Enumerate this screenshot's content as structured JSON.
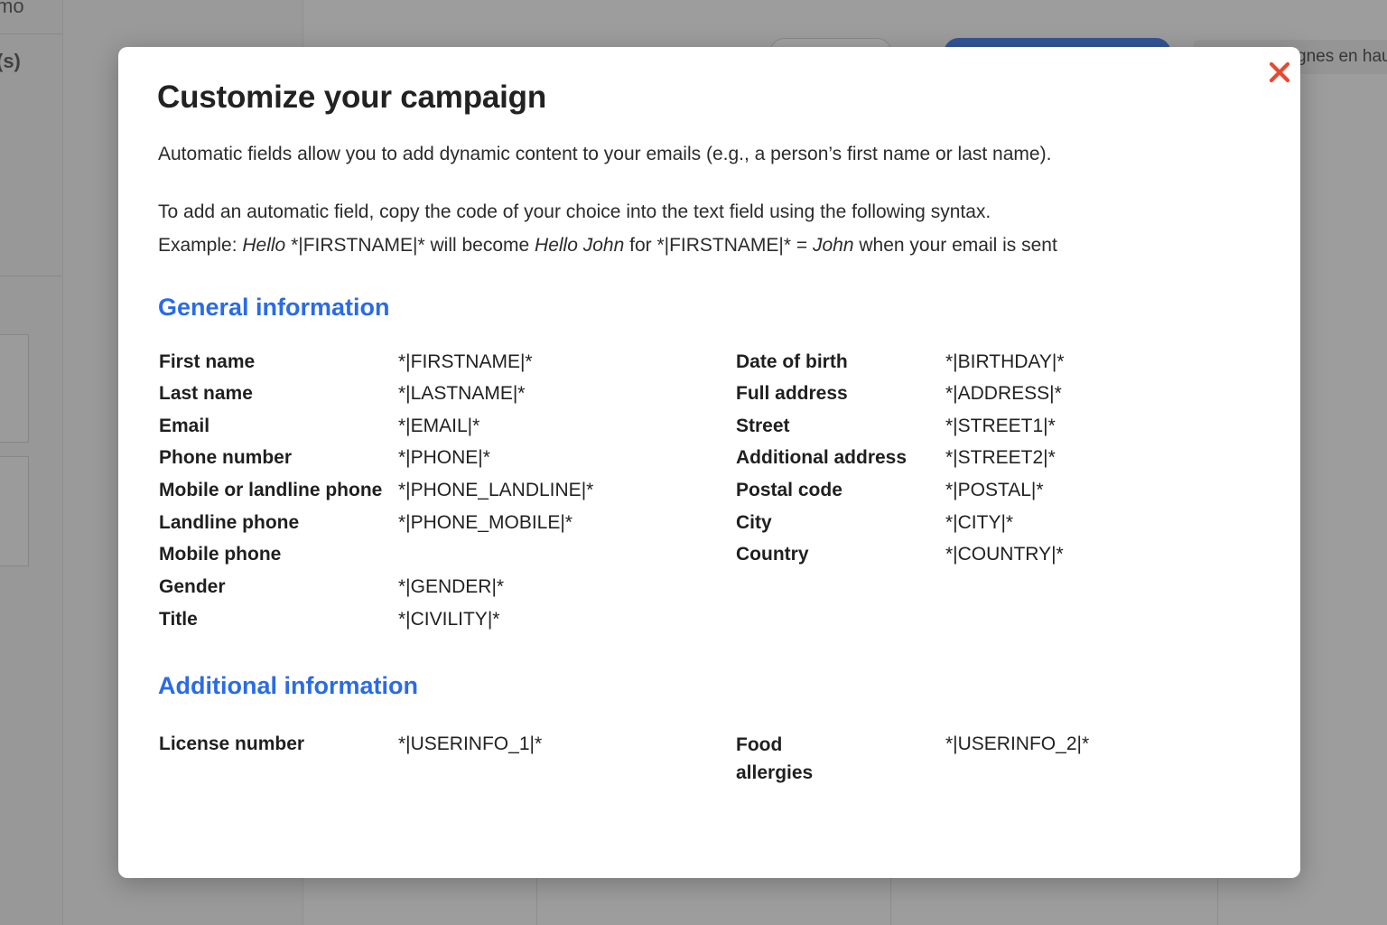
{
  "background": {
    "sidebar_texts": [
      "mo",
      "(s)"
    ],
    "tab_text": "gnes en hau"
  },
  "modal": {
    "title": "Customize your campaign",
    "intro": "Automatic fields allow you to add dynamic content to your emails (e.g., a person’s first name or last name).",
    "syntax_line": "To add an automatic field, copy the code of your choice into the text field using the following syntax.",
    "example": {
      "prefix": "Example: ",
      "hello": "Hello",
      "code1": " *|FIRSTNAME|* ",
      "will_become": "will become ",
      "hello_john": "Hello John",
      "for_text": " for *|FIRSTNAME|* = ",
      "john": "John",
      "suffix": " when your email is sent"
    },
    "close_icon": "close-x-icon",
    "accent_color": "#2a6be6",
    "close_color": "#e8492f"
  },
  "general": {
    "title": "General information",
    "left": [
      {
        "label": "First name",
        "code": "*|FIRSTNAME|*"
      },
      {
        "label": "Last name",
        "code": "*|LASTNAME|*"
      },
      {
        "label": "Email",
        "code": "*|EMAIL|*"
      },
      {
        "label": "Phone number",
        "code": "*|PHONE|*"
      },
      {
        "label": "Mobile or landline phone",
        "code": "*|PHONE_LANDLINE|*"
      },
      {
        "label": "Landline phone",
        "code": "*|PHONE_MOBILE|*"
      },
      {
        "label": "Mobile phone",
        "code": ""
      },
      {
        "label": "Gender",
        "code": "*|GENDER|*"
      },
      {
        "label": "Title",
        "code": "*|CIVILITY|*"
      }
    ],
    "right": [
      {
        "label": "Date of birth",
        "code": "*|BIRTHDAY|*"
      },
      {
        "label": "Full address",
        "code": "*|ADDRESS|*"
      },
      {
        "label": "Street",
        "code": "*|STREET1|*"
      },
      {
        "label": "Additional address",
        "code": "*|STREET2|*"
      },
      {
        "label": "Postal code",
        "code": "*|POSTAL|*"
      },
      {
        "label": "City",
        "code": "*|CITY|*"
      },
      {
        "label": "Country",
        "code": "*|COUNTRY|*"
      }
    ]
  },
  "additional": {
    "title": "Additional information",
    "left": [
      {
        "label": "License number",
        "code": "*|USERINFO_1|*"
      }
    ],
    "right": [
      {
        "label": "Food\nallergies",
        "code": "*|USERINFO_2|*"
      }
    ]
  }
}
